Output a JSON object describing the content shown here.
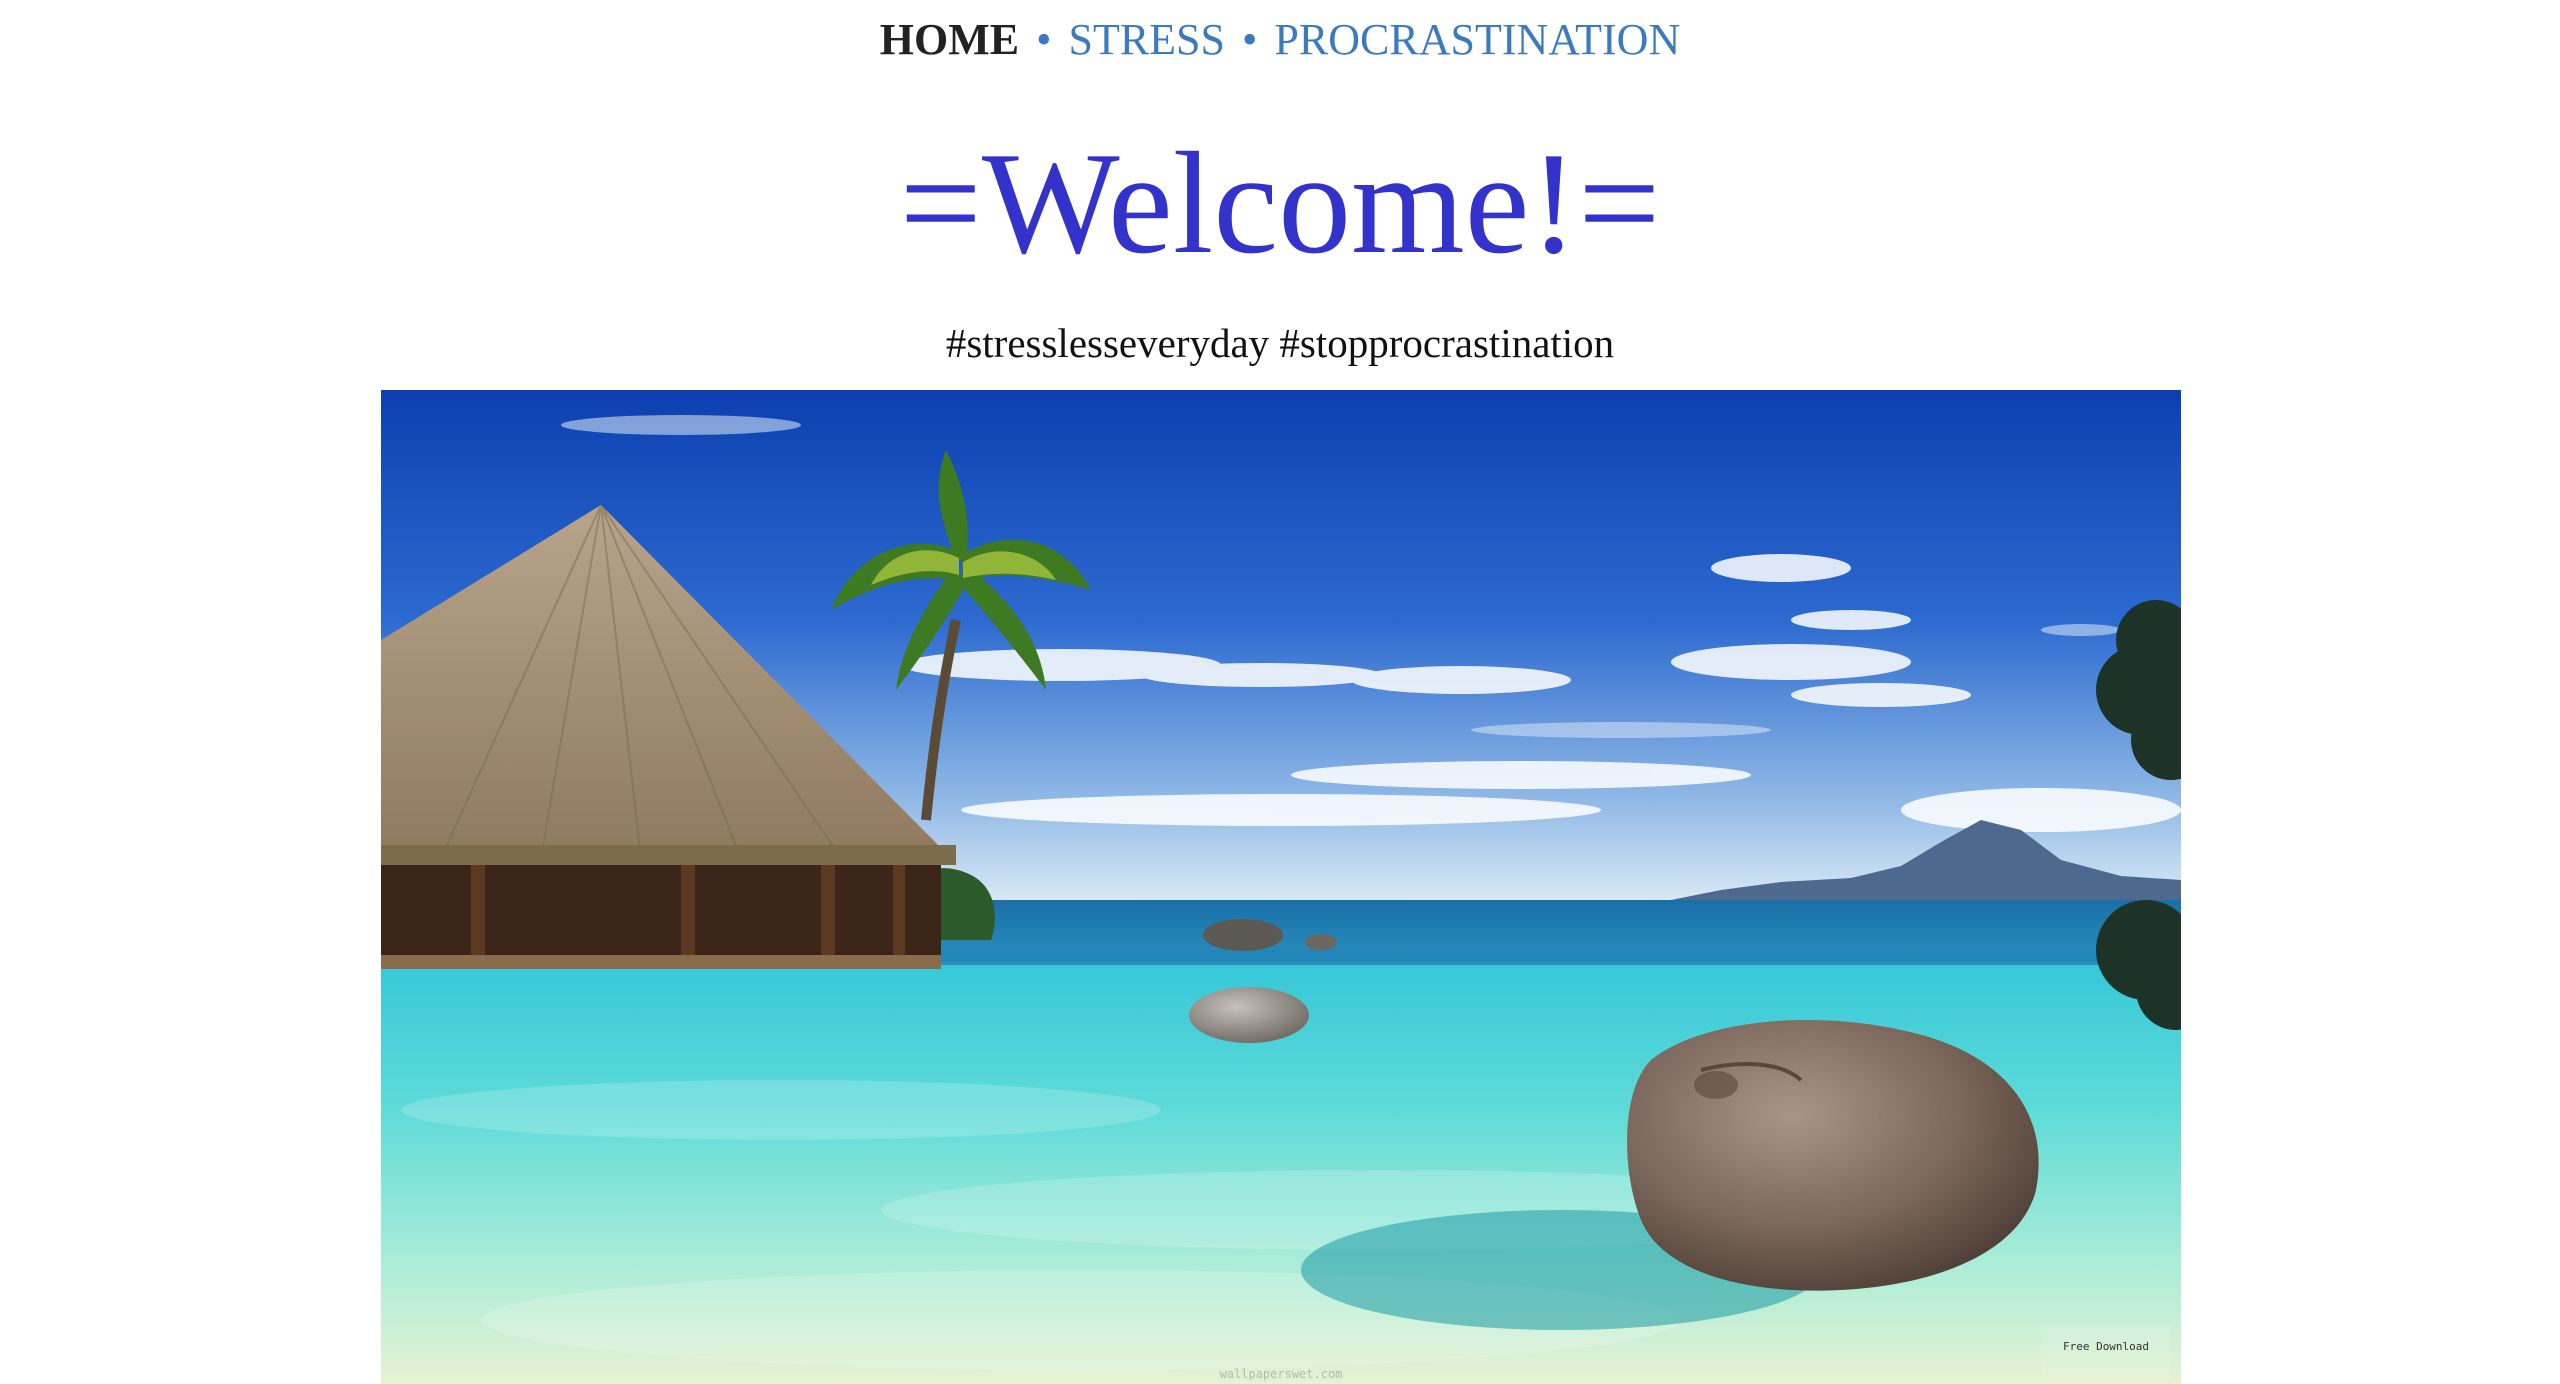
{
  "nav": {
    "home": "HOME",
    "separator": "•",
    "stress": "STRESS",
    "procrastination": "PROCRASTINATION"
  },
  "header": {
    "title": "=Welcome!=",
    "tagline": "#stresslesseveryday #stopprocrastination"
  },
  "hero": {
    "alt": "Tropical beach resort with thatched hut, palm tree, turquoise infinity pool and rocks",
    "watermark_center": "wallpaperswet.com",
    "watermark_corner": "Free Download"
  },
  "colors": {
    "link": "#3a7bbf",
    "title": "#3333cc",
    "home": "#222222"
  }
}
